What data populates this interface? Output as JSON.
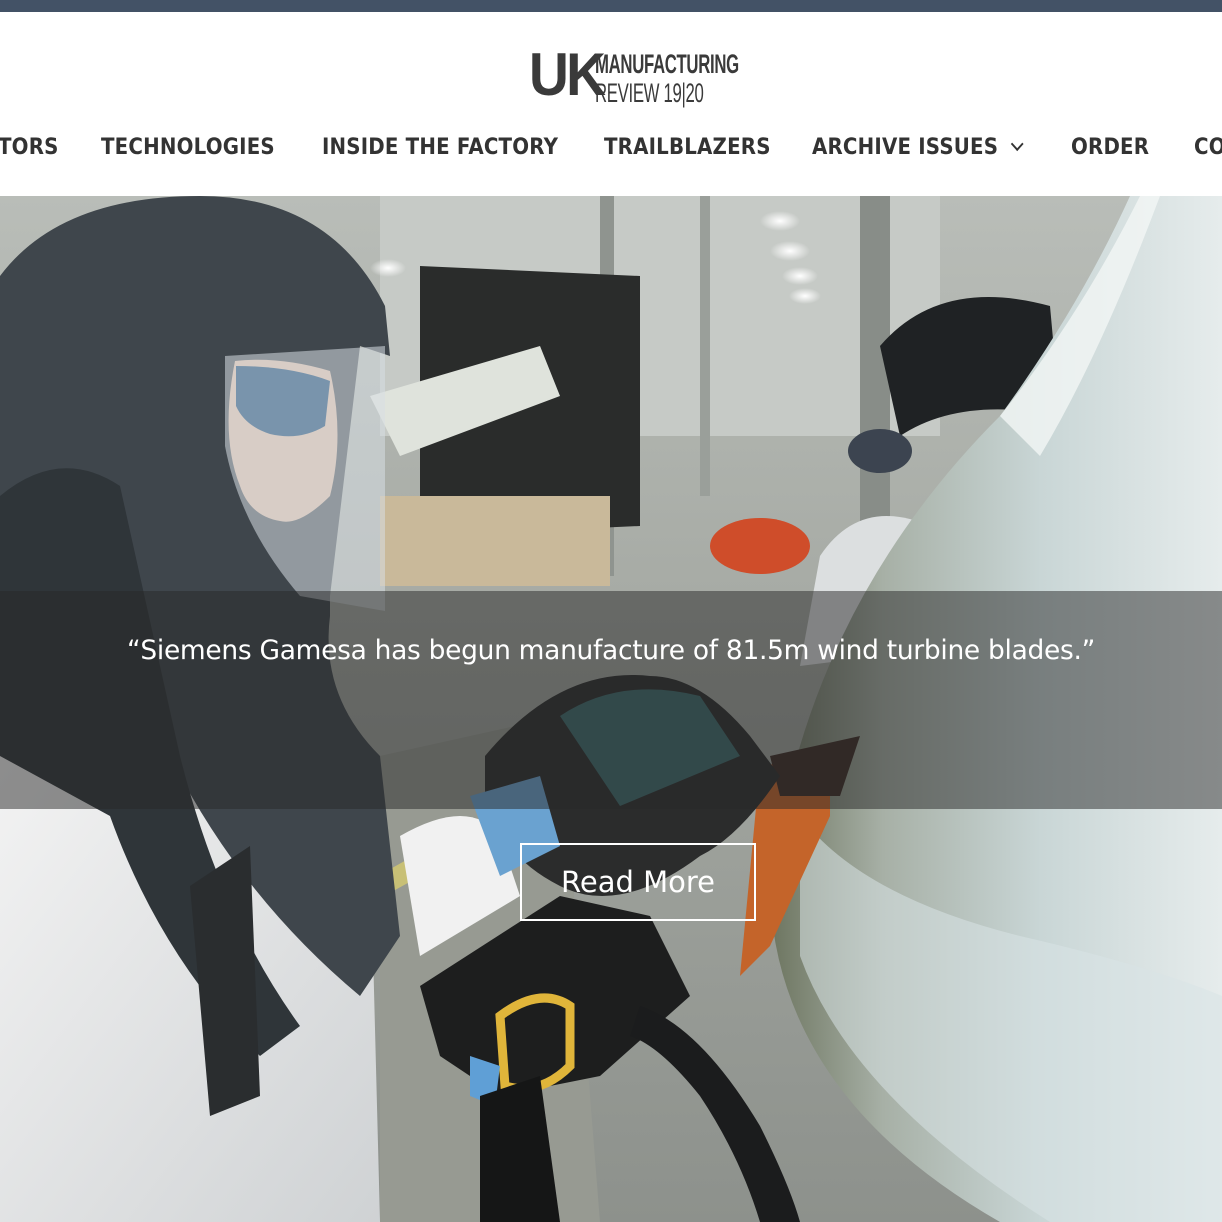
{
  "logo": {
    "mark": "UK",
    "line1": "MANUFACTURING",
    "line2": "REVIEW 19|20"
  },
  "nav": {
    "items": [
      {
        "label": "TORS"
      },
      {
        "label": "TECHNOLOGIES"
      },
      {
        "label": "INSIDE THE FACTORY"
      },
      {
        "label": "TRAILBLAZERS"
      },
      {
        "label": "ARCHIVE ISSUES"
      },
      {
        "label": "ORDER"
      },
      {
        "label": "CO"
      }
    ]
  },
  "hero": {
    "caption": "“Siemens Gamesa has begun manufacture of 81.5m wind turbine blades.”",
    "cta_label": "Read More"
  },
  "colors": {
    "topbar": "#435266",
    "nav_text": "#333333",
    "caption_band": "rgba(40,40,40,0.5)"
  }
}
